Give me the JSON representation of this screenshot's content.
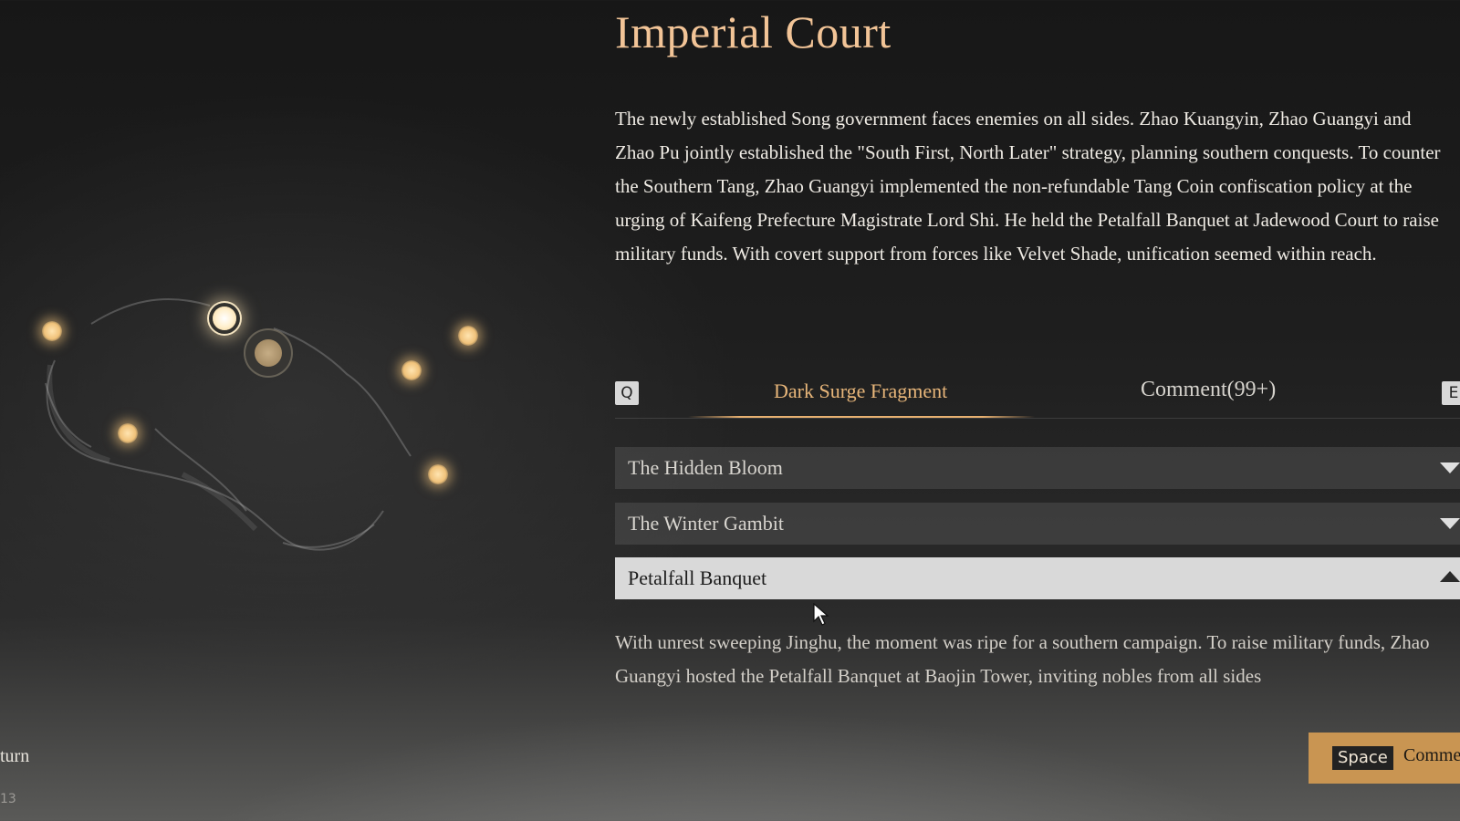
{
  "codex": {
    "title": "Imperial Court",
    "description": "The newly established Song government faces enemies on all sides. Zhao Kuangyin, Zhao Guangyi and Zhao Pu jointly established the \"South First, North Later\" strategy, planning southern conquests. To counter the Southern Tang, Zhao Guangyi implemented the non-refundable Tang Coin confiscation policy at the urging of Kaifeng Prefecture Magistrate Lord Shi. He held the Petalfall Banquet at Jadewood Court to raise military funds. With covert support from forces like Velvet Shade, unification seemed within reach."
  },
  "tabs": {
    "prev_key": "Q",
    "next_key": "E",
    "items": [
      {
        "label": "Dark Surge Fragment",
        "active": true
      },
      {
        "label": "Comment(99+)",
        "active": false
      }
    ]
  },
  "entries": [
    {
      "title": "The Hidden Bloom",
      "expanded": false
    },
    {
      "title": "The Winter Gambit",
      "expanded": false
    },
    {
      "title": "Petalfall Banquet",
      "expanded": true
    }
  ],
  "expanded_entry_text": "With unrest sweeping Jinghu, the moment was ripe for a southern campaign. To raise military funds, Zhao Guangyi hosted the Petalfall Banquet at Baojin Tower, inviting nobles from all sides",
  "action_button": {
    "key": "Space",
    "label": "Comme"
  },
  "bottom_left": {
    "label": "turn",
    "number": "13"
  },
  "colors": {
    "title": "#f2c497",
    "active_tab": "#e8b67a",
    "star": "#f0c27a",
    "action_button": "#c99552"
  }
}
